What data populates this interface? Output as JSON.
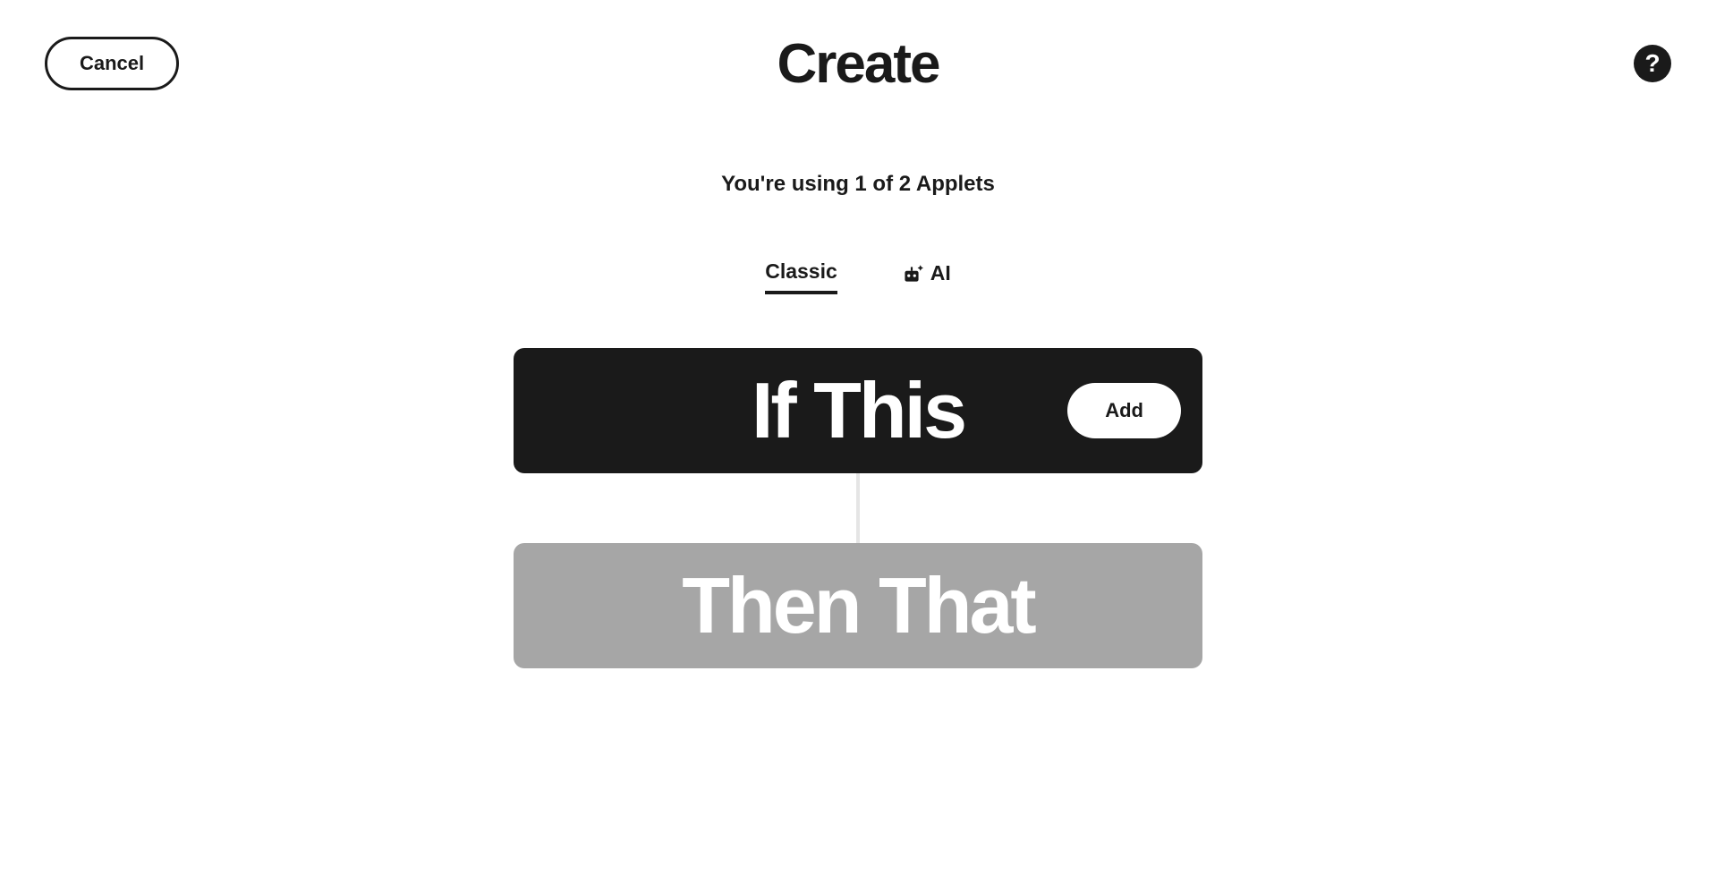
{
  "header": {
    "cancel_label": "Cancel",
    "title": "Create",
    "help_label": "?"
  },
  "usage_text": "You're using 1 of 2 Applets",
  "tabs": {
    "classic_label": "Classic",
    "ai_label": "AI"
  },
  "blocks": {
    "if_label": "If This",
    "then_label": "Then That",
    "add_label": "Add"
  }
}
